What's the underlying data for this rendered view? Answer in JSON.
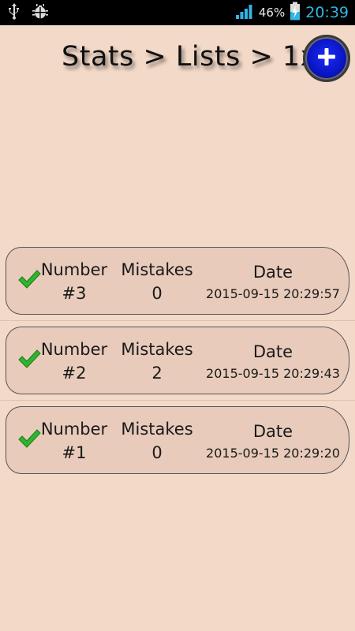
{
  "status_bar": {
    "battery_percent": "46%",
    "time": "20:39",
    "icons": [
      "usb-icon",
      "android-debug-icon",
      "signal-icon",
      "battery-charging-icon"
    ]
  },
  "header": {
    "title": "Stats > Lists > 1x",
    "add_button_icon": "plus-icon"
  },
  "columns": {
    "number": "Number",
    "mistakes": "Mistakes",
    "date": "Date"
  },
  "rows": [
    {
      "number": "#3",
      "mistakes": "0",
      "date": "2015-09-15 20:29:57",
      "status_icon": "checkmark-icon"
    },
    {
      "number": "#2",
      "mistakes": "2",
      "date": "2015-09-15 20:29:43",
      "status_icon": "checkmark-icon"
    },
    {
      "number": "#1",
      "mistakes": "0",
      "date": "2015-09-15 20:29:20",
      "status_icon": "checkmark-icon"
    }
  ],
  "colors": {
    "background": "#f3d9c8",
    "card": "#e8cbbb",
    "accent_blue": "#0a16c4",
    "status_time": "#33b5e5",
    "check_green": "#2fb52f"
  }
}
